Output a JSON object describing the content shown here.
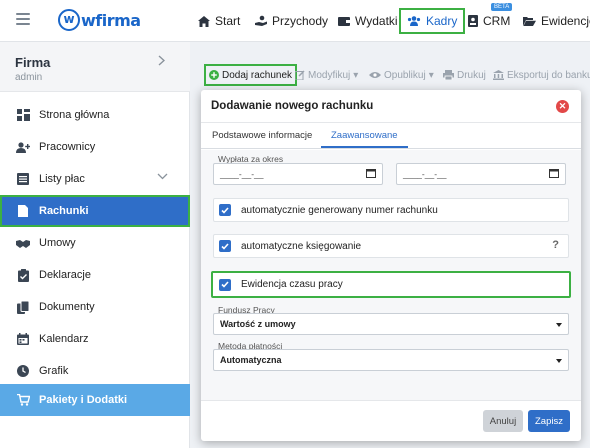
{
  "header": {
    "logo_text": "wfirma",
    "nav": [
      {
        "label": "Start"
      },
      {
        "label": "Przychody"
      },
      {
        "label": "Wydatki"
      },
      {
        "label": "Kadry"
      },
      {
        "label": "CRM",
        "badge": "BETA"
      },
      {
        "label": "Ewidencje"
      }
    ]
  },
  "sidebar": {
    "company_name": "Firma",
    "company_role": "admin",
    "items": [
      {
        "label": "Strona główna"
      },
      {
        "label": "Pracownicy"
      },
      {
        "label": "Listy płac"
      },
      {
        "label": "Rachunki"
      },
      {
        "label": "Umowy"
      },
      {
        "label": "Deklaracje"
      },
      {
        "label": "Dokumenty"
      },
      {
        "label": "Kalendarz"
      },
      {
        "label": "Grafik"
      },
      {
        "label": "Pakiety i Dodatki"
      }
    ]
  },
  "toolbar": {
    "add_label": "Dodaj rachunek",
    "edit_label": "Modyfikuj",
    "publish_label": "Opublikuj",
    "print_label": "Drukuj",
    "export_label": "Eksportuj do banku"
  },
  "modal": {
    "title": "Dodawanie nowego rachunku",
    "tabs": [
      {
        "label": "Podstawowe informacje"
      },
      {
        "label": "Zaawansowane"
      }
    ],
    "payout_label": "Wypłata za okres",
    "date_from_placeholder": "____-__-__",
    "date_to_placeholder": "____-__-__",
    "checkboxes": [
      {
        "label": "automatycznie generowany numer rachunku",
        "checked": true
      },
      {
        "label": "automatyczne księgowanie",
        "checked": true,
        "help": "?"
      },
      {
        "label": "Ewidencja czasu pracy",
        "checked": true
      }
    ],
    "fund_label": "Fundusz Pracy",
    "fund_value": "Wartość z umowy",
    "payment_label": "Metoda płatności",
    "payment_value": "Automatyczna",
    "cancel_label": "Anuluj",
    "save_label": "Zapisz"
  },
  "colors": {
    "accent": "#2f6ec8",
    "highlight": "#3cb043",
    "danger": "#e24848",
    "addons": "#5aa9e6"
  }
}
